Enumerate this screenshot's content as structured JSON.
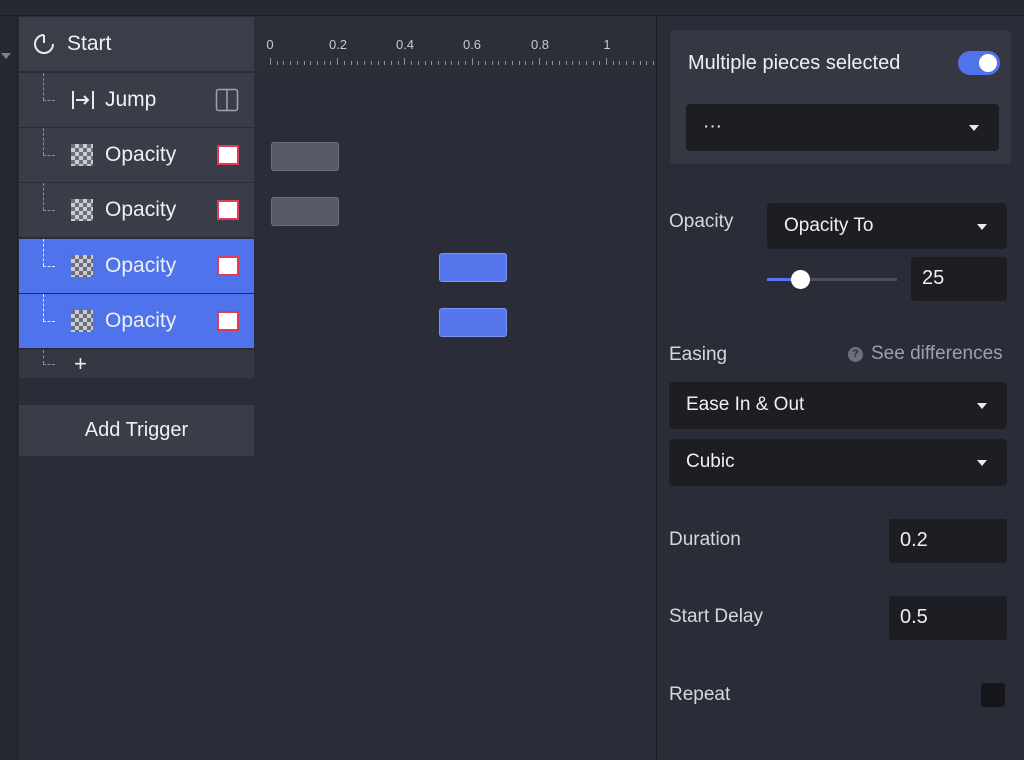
{
  "timeline": {
    "start_label": "Start",
    "rows": [
      {
        "label": "Jump",
        "icon": "jump-icon",
        "selected": false
      },
      {
        "label": "Opacity",
        "icon": "opacity-checker-icon",
        "selected": false
      },
      {
        "label": "Opacity",
        "icon": "opacity-checker-icon",
        "selected": false
      },
      {
        "label": "Opacity",
        "icon": "opacity-checker-icon",
        "selected": true
      },
      {
        "label": "Opacity",
        "icon": "opacity-checker-icon",
        "selected": true
      }
    ],
    "add_label": "+",
    "add_trigger_label": "Add Trigger"
  },
  "ruler": {
    "ticks": [
      "0",
      "0.2",
      "0.4",
      "0.6",
      "0.8",
      "1"
    ]
  },
  "panel": {
    "multi_label": "Multiple pieces selected",
    "multi_toggle_on": true,
    "multi_dropdown_value": "···",
    "opacity_label": "Opacity",
    "opacity_mode": "Opacity To",
    "opacity_value": "25",
    "opacity_fraction": 0.25,
    "easing_label": "Easing",
    "see_differences": "See differences",
    "help_glyph": "?",
    "easing_type": "Ease In & Out",
    "easing_curve": "Cubic",
    "duration_label": "Duration",
    "duration_value": "0.2",
    "start_delay_label": "Start Delay",
    "start_delay_value": "0.5",
    "repeat_label": "Repeat",
    "repeat_checked": false
  },
  "colors": {
    "accent": "#4f73ea",
    "background": "#2a2d37",
    "row": "#3a3d47",
    "swatch_border": "#e03a5a"
  }
}
